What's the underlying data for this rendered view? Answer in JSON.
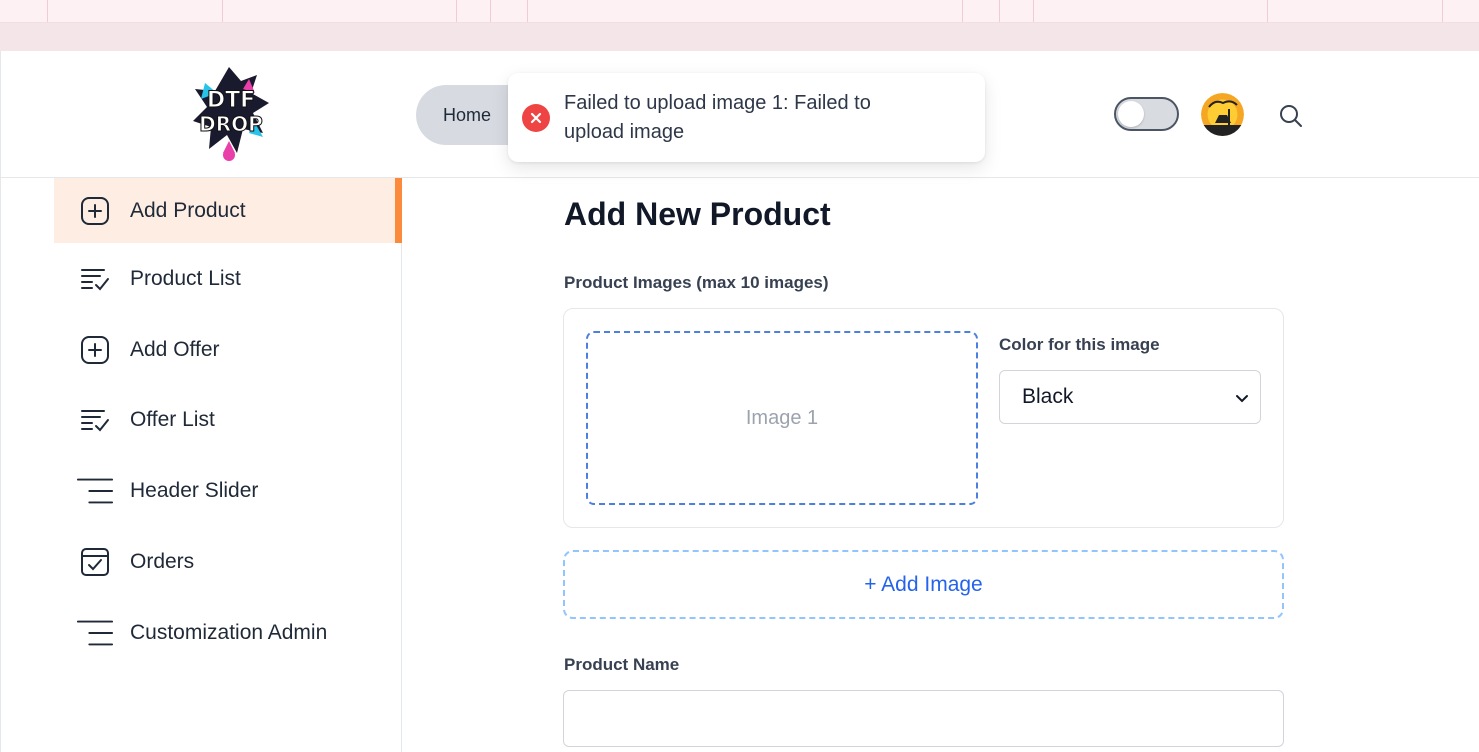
{
  "colors": {
    "accent": "#fb8a3c",
    "active_bg": "#fdede3",
    "error": "#ef4444",
    "link": "#2563eb",
    "dashed_border": "#4c7fe0"
  },
  "header": {
    "logo_alt": "DTF DROP",
    "home_label": "Home",
    "toggle_state": "off",
    "avatar_icon": "avatar-image",
    "search_icon": "search-icon"
  },
  "toast": {
    "type": "error",
    "icon": "error-x-icon",
    "message": "Failed to upload image 1: Failed to upload image"
  },
  "sidebar": {
    "items": [
      {
        "label": "Add Product",
        "icon": "add-square-icon",
        "active": true
      },
      {
        "label": "Product List",
        "icon": "list-check-icon",
        "active": false
      },
      {
        "label": "Add Offer",
        "icon": "add-square-icon",
        "active": false
      },
      {
        "label": "Offer List",
        "icon": "list-check-icon",
        "active": false
      },
      {
        "label": "Header Slider",
        "icon": "menu-lines-icon",
        "active": false
      },
      {
        "label": "Orders",
        "icon": "calendar-check-icon",
        "active": false
      },
      {
        "label": "Customization Admin",
        "icon": "menu-lines-icon",
        "active": false
      }
    ]
  },
  "main": {
    "title": "Add New Product",
    "images_label": "Product Images (max 10 images)",
    "image_slot": {
      "placeholder": "Image 1",
      "color_label": "Color for this image",
      "color_value": "Black"
    },
    "add_image_label": "+ Add Image",
    "product_name_label": "Product Name",
    "product_name_value": ""
  }
}
